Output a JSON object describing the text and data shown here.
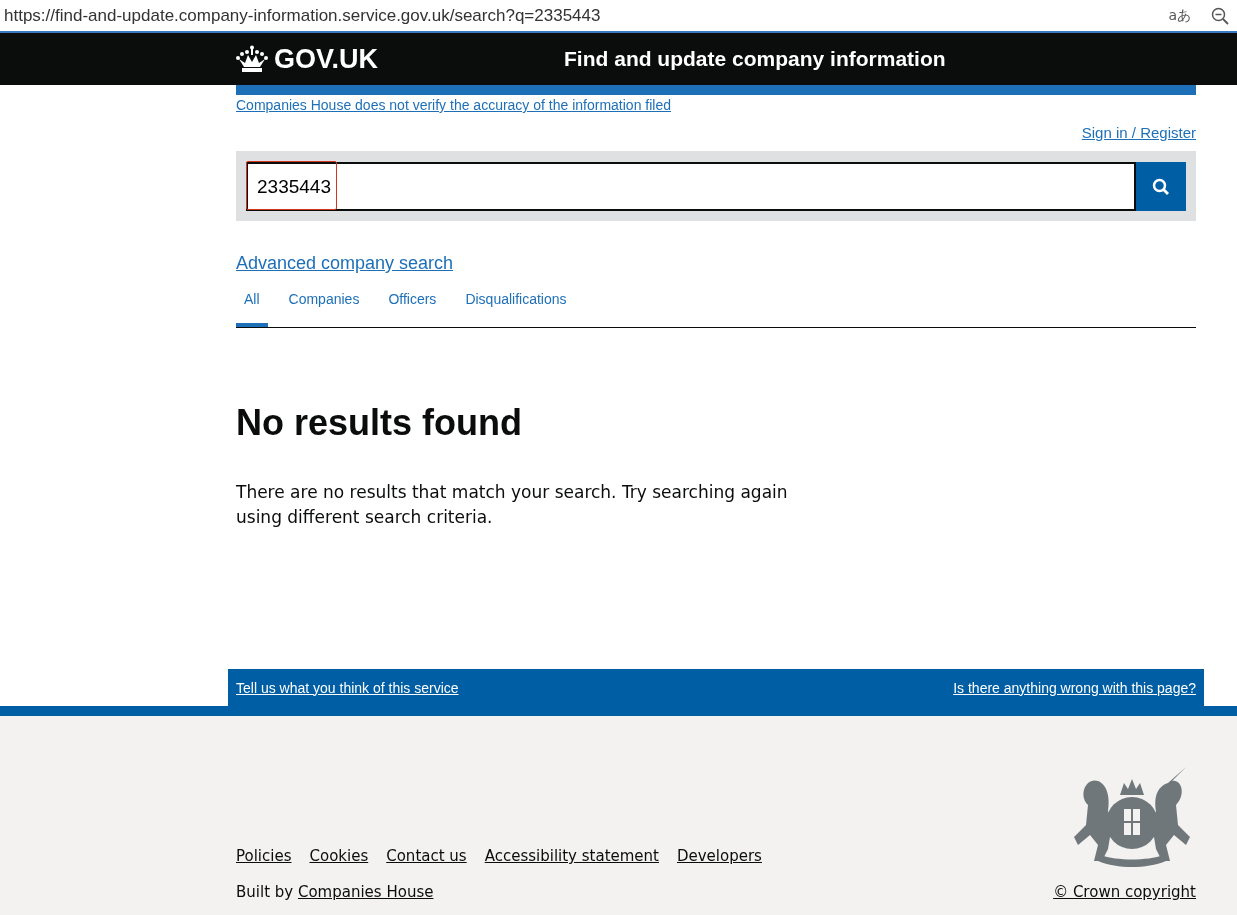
{
  "browser": {
    "url": "https://find-and-update.company-information.service.gov.uk/search?q=2335443",
    "translate_glyph": "aあ"
  },
  "header": {
    "logo": "GOV.UK",
    "service_name": "Find and update company information"
  },
  "notice_link": "Companies House does not verify the accuracy of the information filed",
  "sign_in_link": "Sign in / Register",
  "search": {
    "value": "2335443",
    "highlighted": true
  },
  "advanced_search_link": "Advanced company search",
  "tabs": [
    {
      "label": "All",
      "selected": true
    },
    {
      "label": "Companies",
      "selected": false
    },
    {
      "label": "Officers",
      "selected": false
    },
    {
      "label": "Disqualifications",
      "selected": false
    }
  ],
  "results": {
    "heading": "No results found",
    "message": "There are no results that match your search. Try searching again using different search criteria."
  },
  "feedback": {
    "left_link": "Tell us what you think of this service",
    "right_link": "Is there anything wrong with this page?"
  },
  "footer": {
    "links": [
      "Policies",
      "Cookies",
      "Contact us",
      "Accessibility statement",
      "Developers"
    ],
    "built_by": "Built by",
    "built_by_link": "Companies House",
    "copyright": "© Crown copyright"
  }
}
